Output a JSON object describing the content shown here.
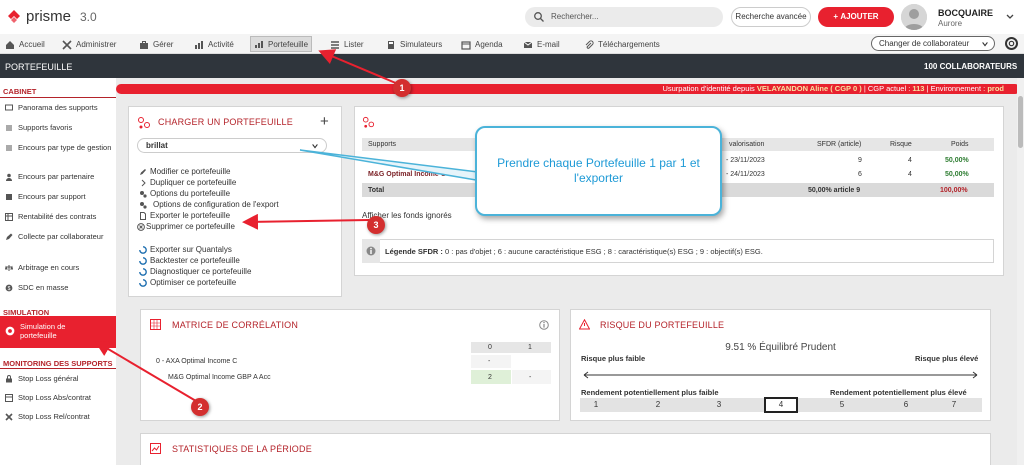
{
  "app": {
    "name": "prisme",
    "version": "3.0"
  },
  "search": {
    "placeholder": "Rechercher..."
  },
  "advanced_search": "Recherche avancée",
  "add_button": "AJOUTER",
  "user": {
    "last_name": "BOCQUAIRE",
    "first_name": "Aurore"
  },
  "nav": {
    "items": [
      "Accueil",
      "Administrer",
      "Gérer",
      "Activité",
      "Portefeuille",
      "Lister",
      "Simulateurs",
      "Agenda",
      "E-mail",
      "Téléchargements"
    ],
    "active": "Portefeuille",
    "switch_label": "Changer de collaborateur"
  },
  "header": {
    "title": "PORTEFEUILLE",
    "collaborators": "100 COLLABORATEURS"
  },
  "sidebar": {
    "cabinet_title": "CABINET",
    "cabinet_items": [
      "Panorama des supports",
      "Supports favoris",
      "Encours par type de gestion",
      "Encours par partenaire",
      "Encours par support",
      "Rentabilité des contrats",
      "Collecte par collaborateur",
      "Arbitrage en cours",
      "SDC en masse"
    ],
    "simulation_title": "SIMULATION",
    "simulation_item": "Simulation de portefeuille",
    "monitoring_title": "MONITORING DES SUPPORTS",
    "monitoring_items": [
      "Stop Loss général",
      "Stop Loss Abs/contrat",
      "Stop Loss Rel/contrat"
    ]
  },
  "banner": {
    "prefix": "Usurpation d'identité depuis",
    "name": "VELAYANDON Aline ( CGP 0 )",
    "cgp_label": "| CGP actuel :",
    "cgp_value": "113",
    "env_label": "| Environnement :",
    "env_value": "prod"
  },
  "load_panel": {
    "title": "CHARGER UN PORTEFEUILLE",
    "plus": "+",
    "selected": "brillat",
    "actions": [
      "Modifier ce portefeuille",
      "Dupliquer ce portefeuille",
      "Options du portefeuille",
      "Options de configuration de l'export",
      "Exporter le portefeuille",
      "Supprimer ce portefeuille"
    ],
    "actions2": [
      "Exporter sur Quantalys",
      "Backtester ce portefeuille",
      "Diagnostiquer ce portefeuille",
      "Optimiser ce portefeuille"
    ]
  },
  "supports_table": {
    "headers": [
      "Supports",
      "valorisation",
      "SFDR (article)",
      "Risque",
      "Poids"
    ],
    "rows": [
      {
        "support": "",
        "date": "- 23/11/2023",
        "sfdr": "9",
        "risk": "4",
        "weight": "50,00%"
      },
      {
        "support": "M&G Optimal Income G",
        "date": "- 24/11/2023",
        "sfdr": "6",
        "risk": "4",
        "weight": "50,00%"
      }
    ],
    "total": {
      "label": "Total",
      "sfdr": "50,00% article 9",
      "weight": "100,00%"
    },
    "show_funds": "Afficher les fonds ignorés",
    "legend_label": "Légende SFDR :",
    "legend_text": "0 : pas d'objet ; 6 : aucune caractéristique ESG ; 8 : caractéristique(s) ESG ; 9 : objectif(s) ESG."
  },
  "callout": {
    "text": "Prendre chaque Portefeuille 1 par 1 et l'exporter"
  },
  "badges": [
    "1",
    "2",
    "3"
  ],
  "correlation": {
    "title": "MATRICE DE CORRÉLATION",
    "cols": [
      "0",
      "1"
    ],
    "rows": [
      {
        "label": "0 - AXA Optimal Income C",
        "values": [
          "-",
          ""
        ]
      },
      {
        "label": "M&G Optimal Income GBP A Acc",
        "values": [
          "2",
          "-"
        ]
      }
    ]
  },
  "risk": {
    "title": "RISQUE DU PORTEFEUILLE",
    "value": "9.51 % Équilibré Prudent",
    "low": "Risque plus faible",
    "high": "Risque plus élevé",
    "yield_low": "Rendement potentiellement plus faible",
    "yield_high": "Rendement potentiellement plus élevé",
    "scale": [
      "1",
      "2",
      "3",
      "4",
      "5",
      "6",
      "7"
    ],
    "selected": "4"
  },
  "stats": {
    "title": "STATISTIQUES DE LA PÉRIODE"
  },
  "colors": {
    "accent": "#e8212f",
    "section": "#b4232a",
    "dark": "#2f353c",
    "callout": "#1e9ad6"
  }
}
